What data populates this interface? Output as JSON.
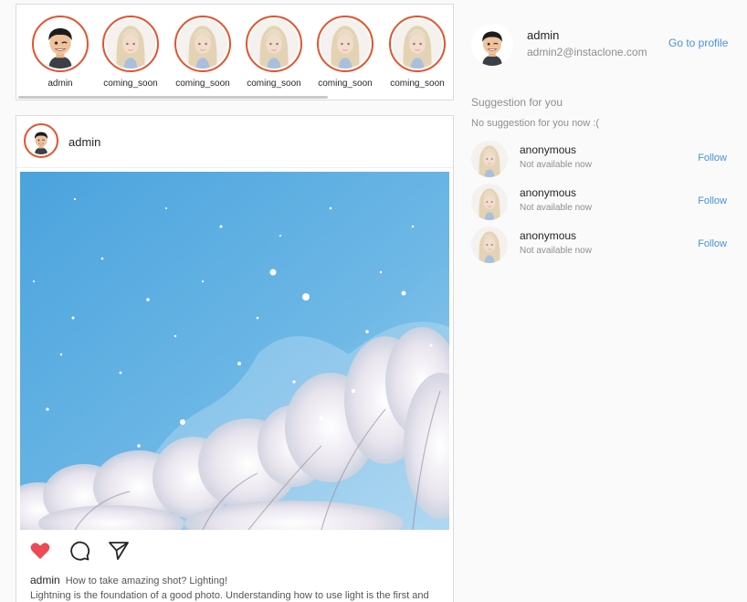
{
  "stories": [
    {
      "label": "admin",
      "avatar": "admin-memoji"
    },
    {
      "label": "coming_soon",
      "avatar": "placeholder-blonde-memoji"
    },
    {
      "label": "coming_soon",
      "avatar": "placeholder-blonde-memoji"
    },
    {
      "label": "coming_soon",
      "avatar": "placeholder-blonde-memoji"
    },
    {
      "label": "coming_soon",
      "avatar": "placeholder-blonde-memoji"
    },
    {
      "label": "coming_soon",
      "avatar": "placeholder-blonde-memoji"
    }
  ],
  "post": {
    "username": "admin",
    "image": "blue sky with falling snow over cherry blossom trees",
    "caption_user": "admin",
    "caption_title": "How to take amazing shot? Lighting!",
    "caption_text": "Lightning is the foundation of a good photo. Understanding how to use light is the first and"
  },
  "profile": {
    "name": "admin",
    "email": "admin2@instaclone.com",
    "link": "Go to profile"
  },
  "suggestions": {
    "title": "Suggestion for you",
    "empty_text": "No suggestion for you now :(",
    "items": [
      {
        "name": "anonymous",
        "status": "Not available now",
        "action": "Follow"
      },
      {
        "name": "anonymous",
        "status": "Not available now",
        "action": "Follow"
      },
      {
        "name": "anonymous",
        "status": "Not available now",
        "action": "Follow"
      }
    ]
  },
  "colors": {
    "story_ring": "#e4532d",
    "link": "#4a90d9",
    "like": "#ed4956",
    "sky": "#4aa3dd"
  }
}
